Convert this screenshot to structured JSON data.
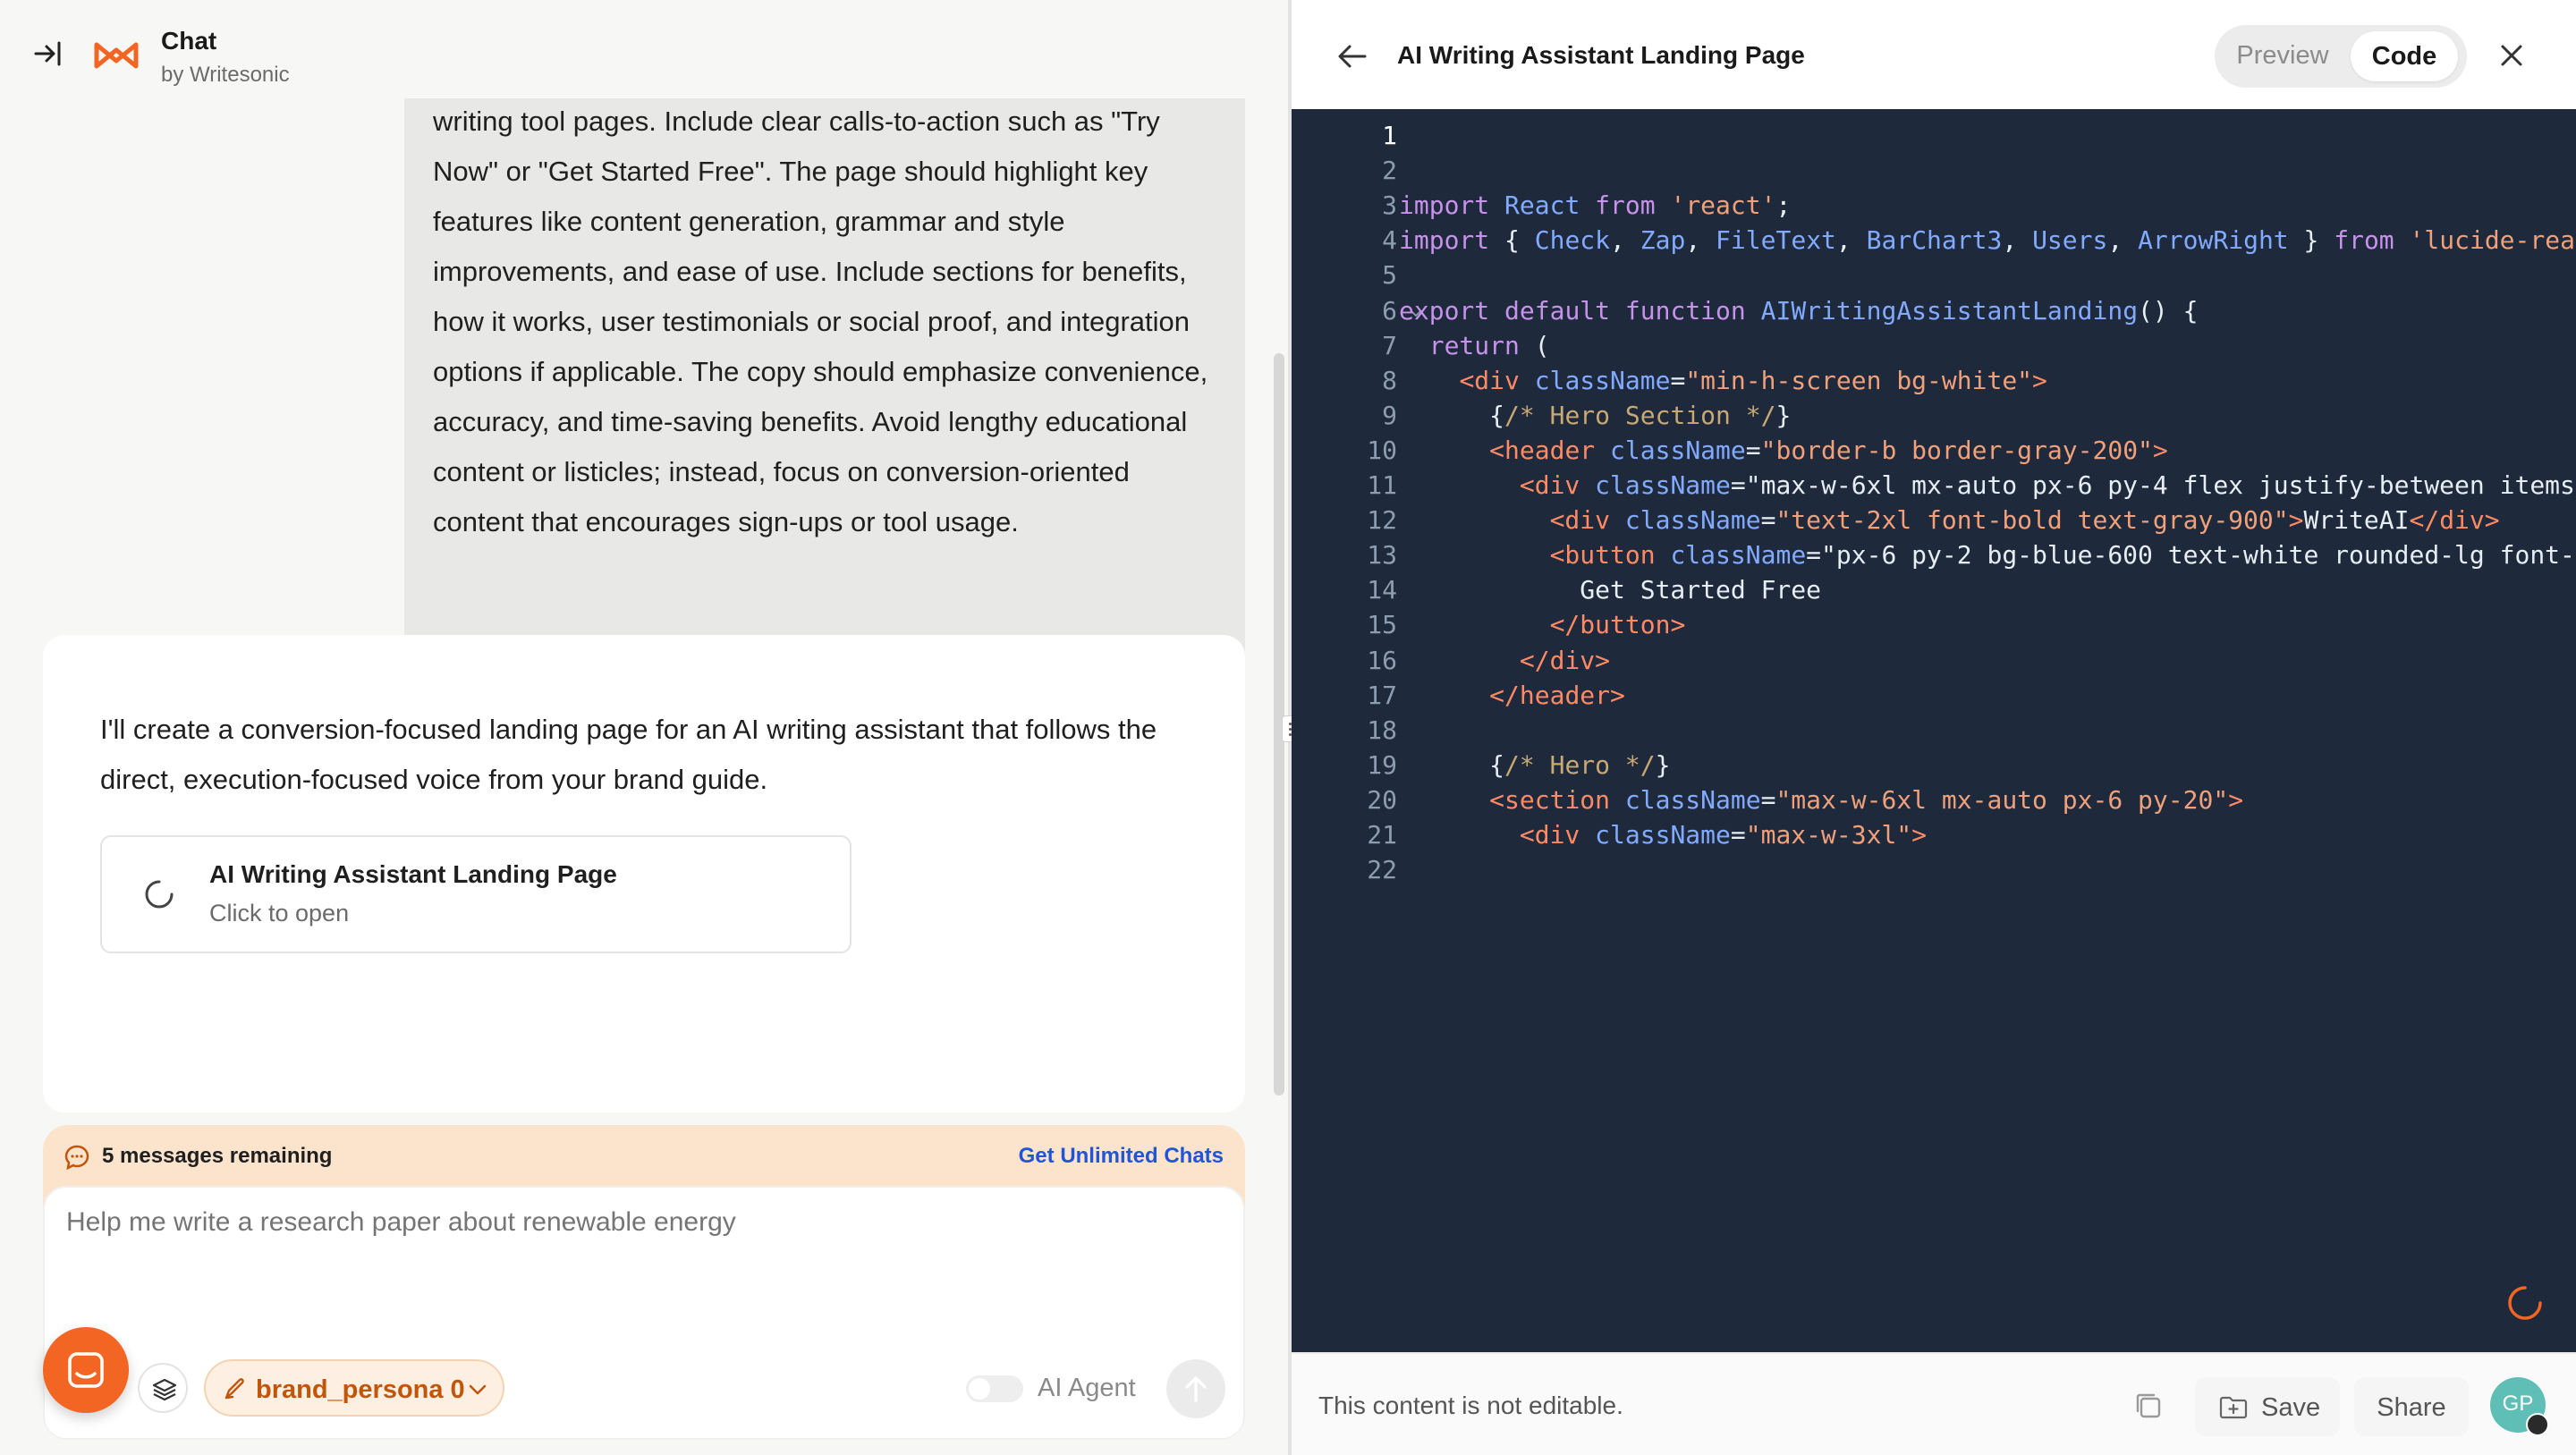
{
  "app": {
    "title": "Chat",
    "subtitle": "by Writesonic"
  },
  "conversation": {
    "user_message": "writing tool pages. Include clear calls-to-action such as \"Try Now\" or \"Get Started Free\". The page should highlight key features like content generation, grammar and style improvements, and ease of use. Include sections for benefits, how it works, user testimonials or social proof, and integration options if applicable. The copy should emphasize convenience, accuracy, and time-saving benefits. Avoid lengthy educational content or listicles; instead, focus on conversion-oriented content that encourages sign-ups or tool usage.",
    "assistant_message": "I'll create a conversion-focused landing page for an AI writing assistant that follows the direct, execution-focused voice from your brand guide.",
    "artifact_card": {
      "title": "AI Writing Assistant Landing Page",
      "subtitle": "Click to open"
    }
  },
  "composer": {
    "quota_text": "5 messages remaining",
    "upgrade_link": "Get Unlimited Chats",
    "placeholder": "Help me write a research paper about renewable energy",
    "persona_label": "brand_persona 0",
    "agent_label": "AI Agent",
    "agent_enabled": false
  },
  "artifact_panel": {
    "title": "AI Writing Assistant Landing Page",
    "view_tabs": [
      "Preview",
      "Code"
    ],
    "active_tab": "Code",
    "footer_note": "This content is not editable.",
    "save_label": "Save",
    "share_label": "Share",
    "avatar_initials": "GP",
    "active_line": 1
  },
  "code_lines": [
    "",
    "",
    "import React from 'react';",
    "import { Check, Zap, FileText, BarChart3, Users, ArrowRight } from 'lucide-rea",
    "",
    "export default function AIWritingAssistantLanding() {",
    "  return (",
    "    <div className=\"min-h-screen bg-white\">",
    "      {/* Hero Section */}",
    "      <header className=\"border-b border-gray-200\">",
    "        <div className=\"max-w-6xl mx-auto px-6 py-4 flex justify-between items",
    "          <div className=\"text-2xl font-bold text-gray-900\">WriteAI</div>",
    "          <button className=\"px-6 py-2 bg-blue-600 text-white rounded-lg font-",
    "            Get Started Free",
    "          </button>",
    "        </div>",
    "      </header>",
    "",
    "      {/* Hero */}",
    "      <section className=\"max-w-6xl mx-auto px-6 py-20\">",
    "        <div className=\"max-w-3xl\">",
    ""
  ],
  "colors": {
    "brand_orange": "#f26522",
    "editor_bg": "#1e293b",
    "link_blue": "#1f55d6",
    "quota_bg": "#fbe3cc"
  },
  "icons": {
    "collapse": "collapse-sidebar-icon",
    "logo": "writesonic-logo-icon",
    "spinner": "loading-spinner-icon",
    "sparkle": "sparkle-icon",
    "back": "arrow-left-icon",
    "close": "close-icon",
    "copy": "copy-icon",
    "save": "folder-save-icon"
  }
}
